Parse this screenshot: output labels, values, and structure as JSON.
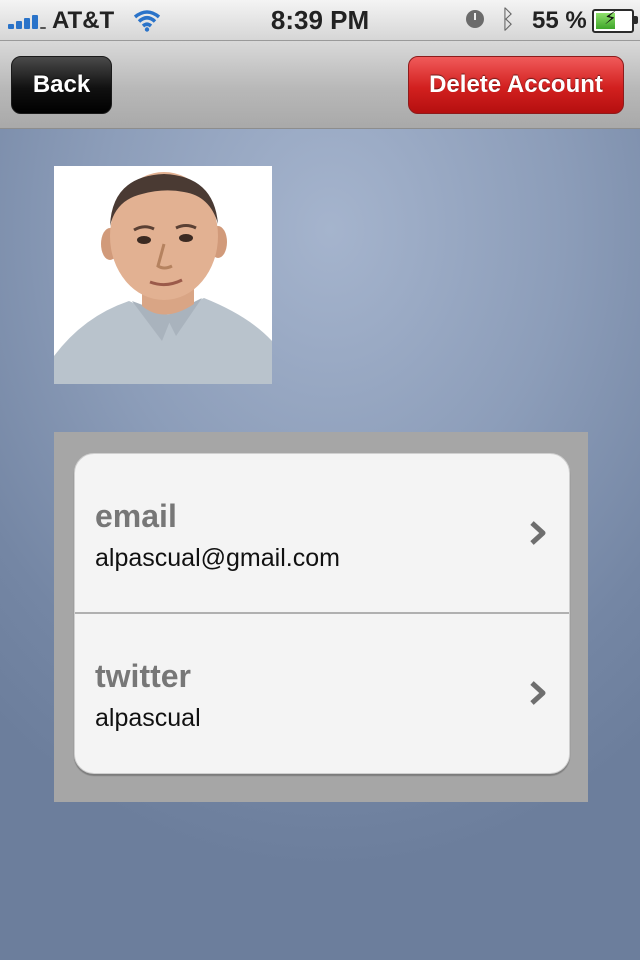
{
  "status_bar": {
    "carrier": "AT&T",
    "time": "8:39 PM",
    "battery_percent": "55 %",
    "battery_level": 0.55,
    "icons": [
      "signal-icon",
      "wifi-icon",
      "clock-icon",
      "bluetooth-icon",
      "battery-icon"
    ]
  },
  "nav": {
    "back_label": "Back",
    "delete_label": "Delete Account"
  },
  "profile": {
    "fields": [
      {
        "label": "email",
        "value": "alpascual@gmail.com"
      },
      {
        "label": "twitter",
        "value": "alpascual"
      }
    ]
  },
  "colors": {
    "delete_button": "#d2201f",
    "back_button": "#111111",
    "background": "#8c9db9"
  }
}
